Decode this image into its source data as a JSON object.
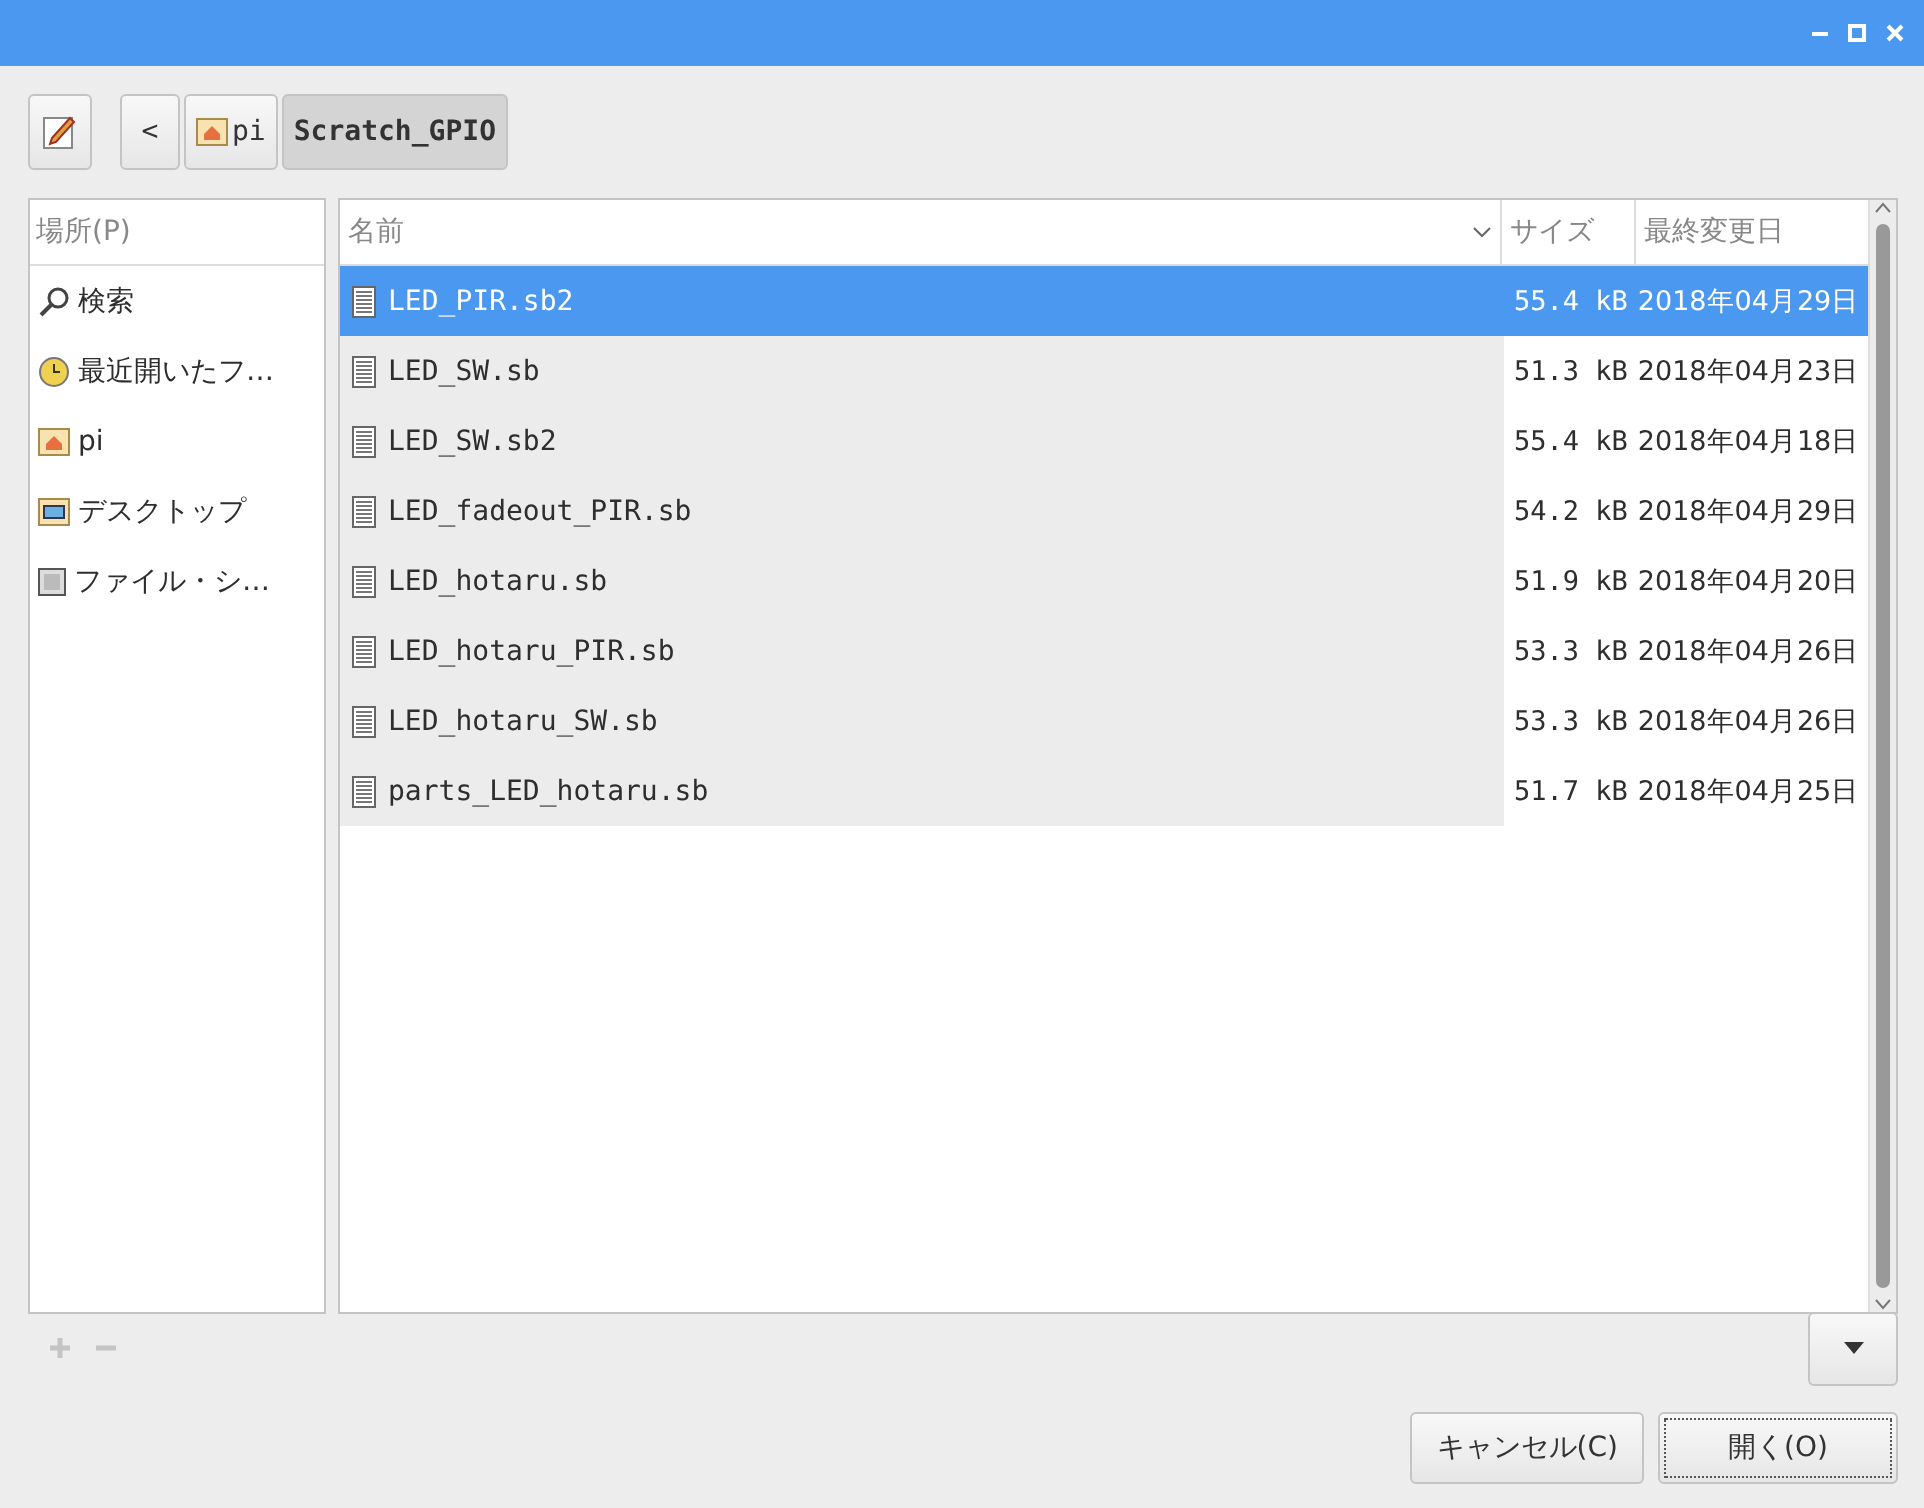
{
  "toolbar": {
    "back": "<",
    "path": [
      {
        "label": "pi",
        "kind": "home",
        "selected": false
      },
      {
        "label": "Scratch_GPIO",
        "kind": "plain",
        "selected": true
      }
    ]
  },
  "places": {
    "heading": "場所(P)",
    "items": [
      {
        "label": "検索",
        "kind": "search"
      },
      {
        "label": "最近開いたフ…",
        "kind": "recent"
      },
      {
        "label": "pi",
        "kind": "home"
      },
      {
        "label": "デスクトップ",
        "kind": "desktop"
      },
      {
        "label": "ファイル・シ…",
        "kind": "drive"
      }
    ]
  },
  "files": {
    "columns": [
      "名前",
      "サイズ",
      "最終変更日"
    ],
    "rows": [
      {
        "name": "LED_PIR.sb2",
        "size": "55.4 kB",
        "date": "2018年04月29日",
        "selected": true
      },
      {
        "name": "LED_SW.sb",
        "size": "51.3 kB",
        "date": "2018年04月23日",
        "selected": false
      },
      {
        "name": "LED_SW.sb2",
        "size": "55.4 kB",
        "date": "2018年04月18日",
        "selected": false
      },
      {
        "name": "LED_fadeout_PIR.sb",
        "size": "54.2 kB",
        "date": "2018年04月29日",
        "selected": false
      },
      {
        "name": "LED_hotaru.sb",
        "size": "51.9 kB",
        "date": "2018年04月20日",
        "selected": false
      },
      {
        "name": "LED_hotaru_PIR.sb",
        "size": "53.3 kB",
        "date": "2018年04月26日",
        "selected": false
      },
      {
        "name": "LED_hotaru_SW.sb",
        "size": "53.3 kB",
        "date": "2018年04月26日",
        "selected": false
      },
      {
        "name": "parts_LED_hotaru.sb",
        "size": "51.7 kB",
        "date": "2018年04月25日",
        "selected": false
      }
    ]
  },
  "buttons": [
    {
      "label": "キャンセル(C)",
      "kind": "cancel"
    },
    {
      "label": "開く(O)",
      "kind": "open"
    }
  ]
}
